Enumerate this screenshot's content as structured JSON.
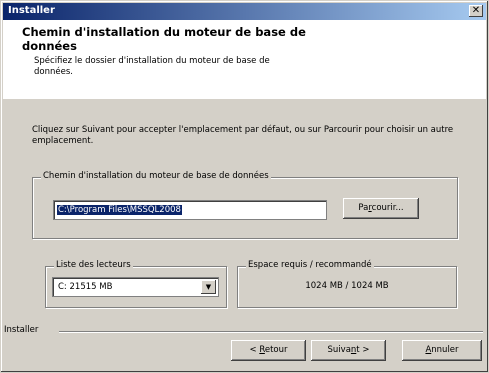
{
  "window": {
    "title": "Installer",
    "close_label": "✕"
  },
  "header": {
    "title": "Chemin d'installation du moteur de base de données",
    "subtitle": "Spécifiez le dossier d'installation du moteur de base de données."
  },
  "instructions": "Cliquez sur Suivant pour accepter l'emplacement par défaut, ou sur Parcourir pour choisir un autre emplacement.",
  "install_path_group": {
    "legend": "Chemin d'installation du moteur de base de données",
    "path_value": "C:\\Program Files\\MSSQL2008",
    "browse_label_pre": "Pa",
    "browse_label_u": "r",
    "browse_label_post": "courir..."
  },
  "drives_group": {
    "legend": "Liste des lecteurs",
    "selected": "C:  21515 MB"
  },
  "space_group": {
    "legend": "Espace requis / recommandé",
    "value": "1024 MB / 1024 MB"
  },
  "footer": {
    "brand": "Installer",
    "back_pre": "< ",
    "back_u": "R",
    "back_post": "etour",
    "next_pre": "Suiva",
    "next_u": "n",
    "next_post": "t >",
    "cancel_u": "A",
    "cancel_post": "nnuler"
  }
}
